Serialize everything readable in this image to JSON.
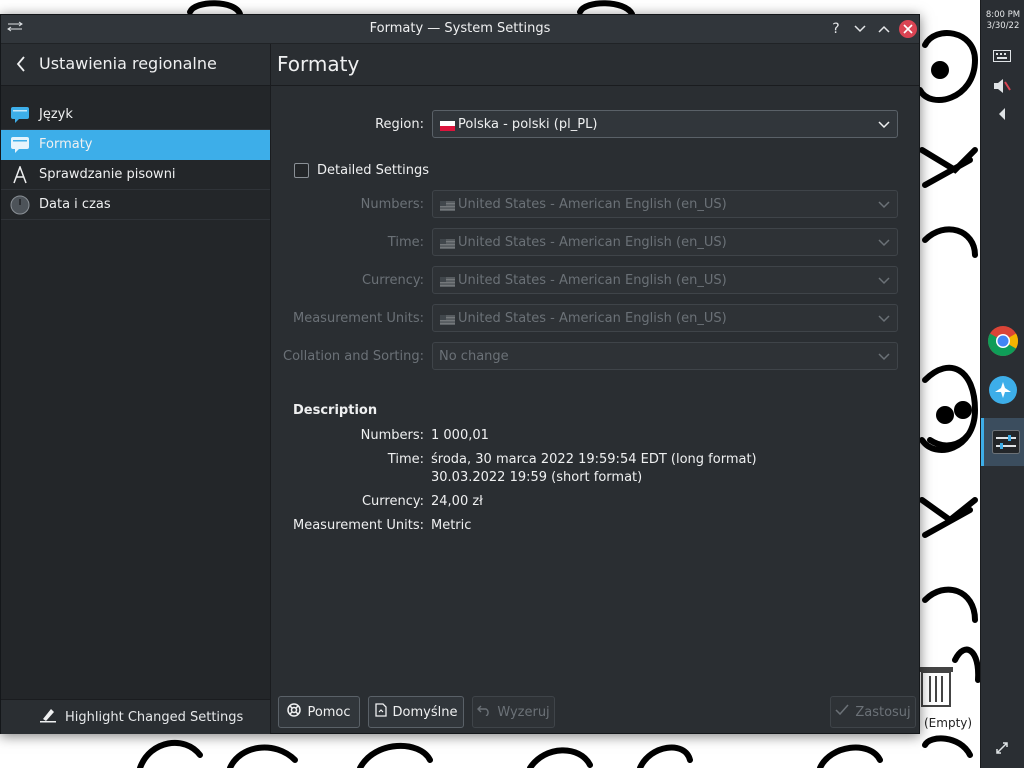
{
  "window": {
    "title": "Formaty — System Settings",
    "buttons": {
      "help": "?",
      "minimize": "⌄",
      "maximize": "⌃",
      "close": "✕"
    }
  },
  "sidebar": {
    "title": "Ustawienia regionalne",
    "items": [
      {
        "label": "Język",
        "icon": "language-icon",
        "selected": false
      },
      {
        "label": "Formaty",
        "icon": "formats-icon",
        "selected": true
      },
      {
        "label": "Sprawdzanie pisowni",
        "icon": "spellcheck-icon",
        "selected": false
      },
      {
        "label": "Data i czas",
        "icon": "clock-icon",
        "selected": false
      }
    ],
    "footer_button": "Highlight Changed Settings"
  },
  "main": {
    "title": "Formaty",
    "region": {
      "label": "Region:",
      "value": "Polska - polski (pl_PL)"
    },
    "detailed_settings": {
      "label": "Detailed Settings",
      "checked": false
    },
    "detail_rows": [
      {
        "label": "Numbers:",
        "value": "United States - American English (en_US)",
        "flag": true
      },
      {
        "label": "Time:",
        "value": "United States - American English (en_US)",
        "flag": true
      },
      {
        "label": "Currency:",
        "value": "United States - American English (en_US)",
        "flag": true
      },
      {
        "label": "Measurement Units:",
        "value": "United States - American English (en_US)",
        "flag": true
      },
      {
        "label": "Collation and Sorting:",
        "value": "No change",
        "flag": false
      }
    ],
    "description": {
      "title": "Description",
      "numbers_label": "Numbers:",
      "numbers_value": "1 000,01",
      "time_label": "Time:",
      "time_long": "środa, 30 marca 2022 19:59:54 EDT (long format)",
      "time_short": "30.03.2022 19:59 (short format)",
      "currency_label": "Currency:",
      "currency_value": "24,00 zł",
      "units_label": "Measurement Units:",
      "units_value": "Metric"
    }
  },
  "buttons": {
    "help": "Pomoc",
    "defaults": "Domyślne",
    "reset": "Wyzeruj",
    "apply": "Zastosuj"
  },
  "panel": {
    "time": "8:00 PM",
    "date": "3/30/22"
  },
  "desktop": {
    "trash_label": "(Empty)"
  },
  "colors": {
    "accent": "#3daee9",
    "window_bg": "#2a2e32",
    "sidebar_bg": "#232629",
    "close_button": "#da4453"
  }
}
